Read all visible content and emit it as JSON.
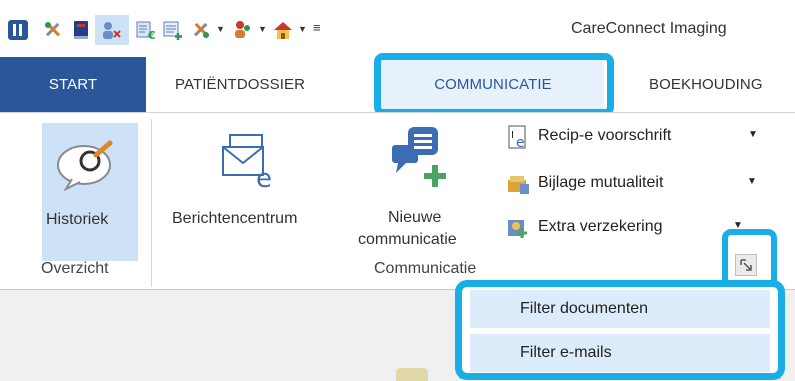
{
  "window": {
    "title": "CareConnect Imaging"
  },
  "tabs": [
    {
      "label": "START"
    },
    {
      "label": "PATIËNTDOSSIER"
    },
    {
      "label": "COMMUNICATIE"
    },
    {
      "label": "BOEKHOUDING"
    }
  ],
  "ribbon": {
    "historiek_label": "Historiek",
    "overzicht_group": "Overzicht",
    "berichtencentrum_label": "Berichtencentrum",
    "nieuwe_label_line1": "Nieuwe",
    "nieuwe_label_line2": "communicatie",
    "communicatie_group": "Communicatie",
    "small_buttons": [
      {
        "label": "Recip-e voorschrift",
        "icon": "prescription-icon"
      },
      {
        "label": "Bijlage mutualiteit",
        "icon": "mutuality-icon"
      },
      {
        "label": "Extra verzekering",
        "icon": "insurance-icon"
      }
    ]
  },
  "dropdown_menu": {
    "items": [
      {
        "label": "Filter documenten"
      },
      {
        "label": "Filter e-mails"
      }
    ]
  },
  "colors": {
    "accent": "#2b579a",
    "highlight": "#19aee6",
    "selected_tab_bg": "#e7f1fb",
    "button_pressed_bg": "#cde1f7",
    "menu_item_hover": "#dcecfb"
  }
}
